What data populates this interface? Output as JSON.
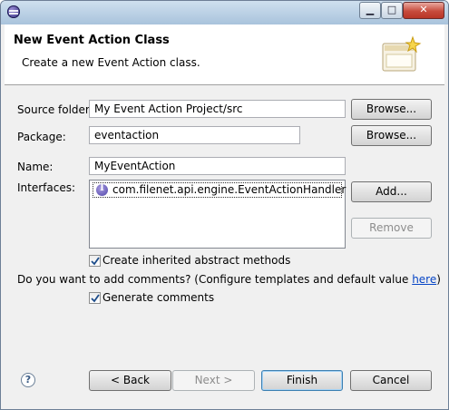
{
  "window": {
    "title": ""
  },
  "banner": {
    "title": "New Event Action Class",
    "description": "Create a new Event Action class."
  },
  "form": {
    "source_folder": {
      "label": "Source folder:",
      "value": "My Event Action Project/src",
      "browse": "Browse..."
    },
    "package": {
      "label": "Package:",
      "value": "eventaction",
      "browse": "Browse..."
    },
    "name": {
      "label": "Name:",
      "value": "MyEventAction"
    },
    "interfaces": {
      "label": "Interfaces:",
      "items": [
        "com.filenet.api.engine.EventActionHandler"
      ],
      "add": "Add...",
      "remove": "Remove"
    },
    "inherited_methods": {
      "label": "Create inherited abstract methods",
      "checked": true
    },
    "comments_prompt": "Do you want to add comments? (Configure templates and default value ",
    "comments_link": "here",
    "comments_suffix": ")",
    "generate_comments": {
      "label": "Generate comments",
      "checked": true
    }
  },
  "footer": {
    "back": "< Back",
    "next": "Next >",
    "finish": "Finish",
    "cancel": "Cancel"
  },
  "icons": {
    "app": "eclipse-icon",
    "interface": "interface-icon",
    "wizard": "new-class-wizard-icon",
    "help": "help-icon"
  }
}
